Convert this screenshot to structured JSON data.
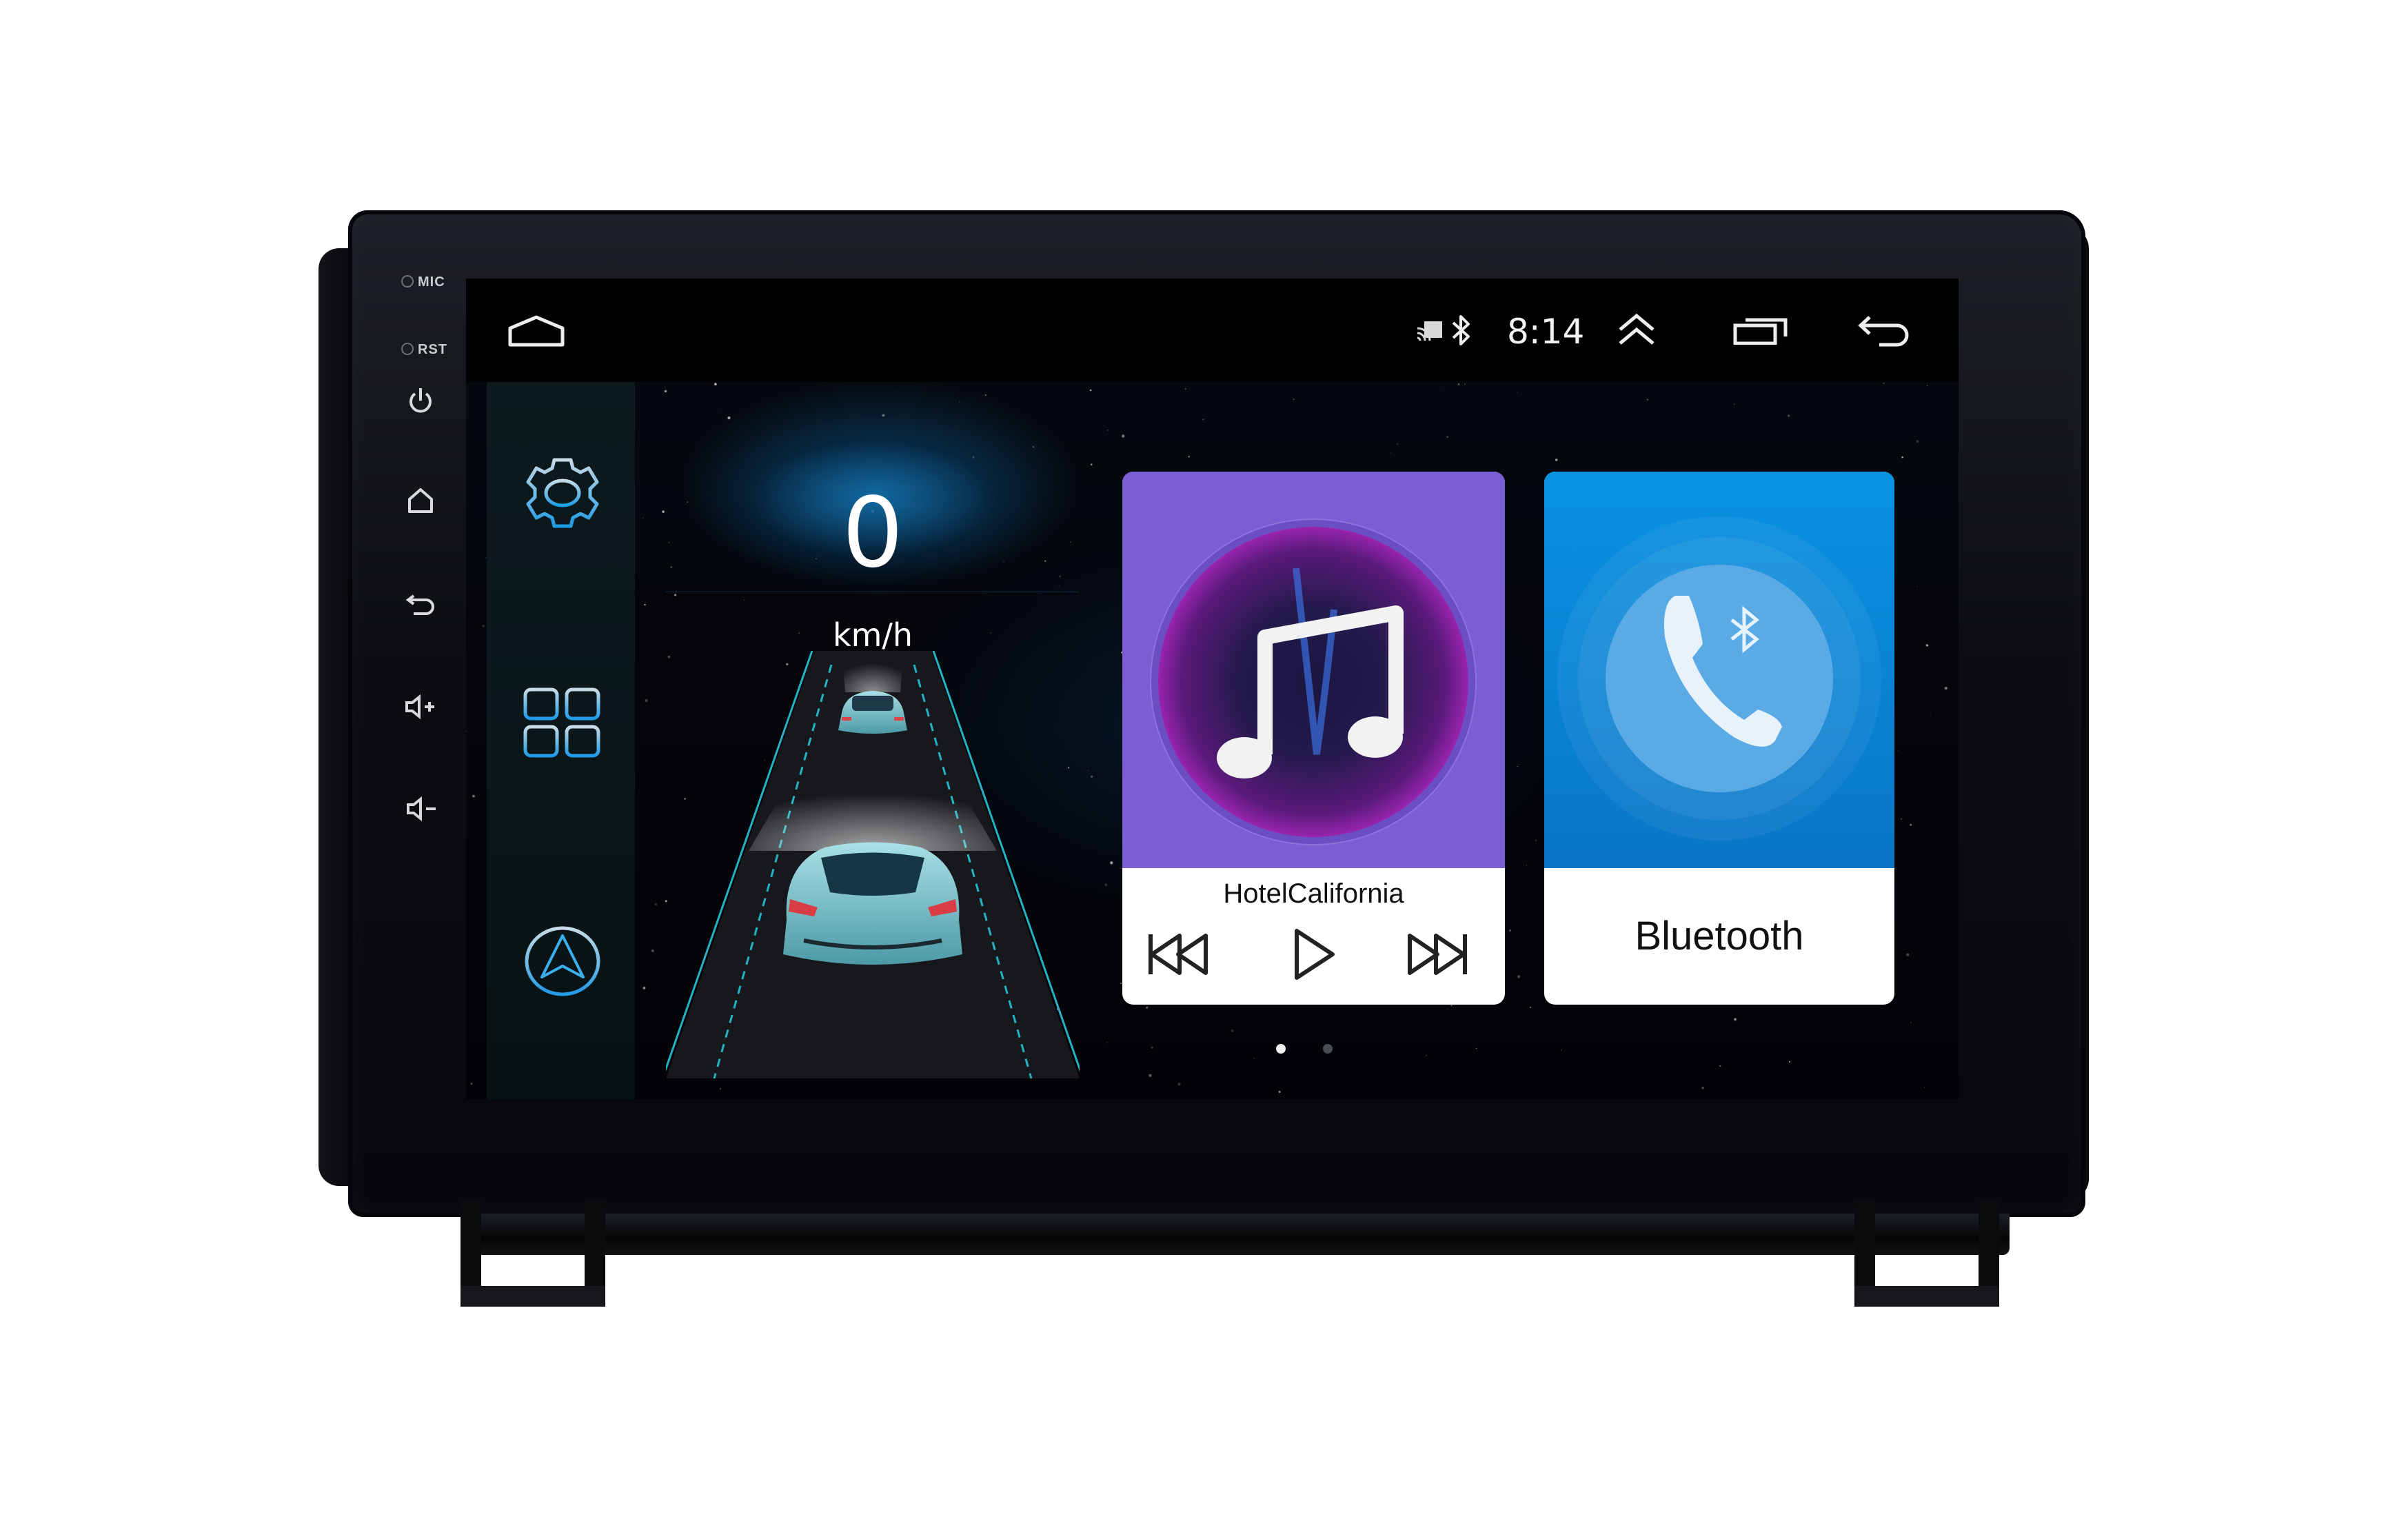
{
  "device": {
    "hardware_labels": {
      "mic": "MIC",
      "rst": "RST"
    },
    "hardware_buttons": [
      "power-icon",
      "home-icon",
      "back-icon",
      "volume-up-icon",
      "volume-down-icon"
    ]
  },
  "status_bar": {
    "home_icon": "home-icon",
    "cast_icon": "cast-icon",
    "bluetooth_icon": "bluetooth-icon",
    "time": "8:14",
    "expand_icon": "double-chevron-up-icon",
    "recents_icon": "recent-apps-icon",
    "back_icon": "back-icon"
  },
  "dock": {
    "items": [
      {
        "name": "settings",
        "icon": "gear-icon"
      },
      {
        "name": "apps",
        "icon": "app-grid-icon"
      },
      {
        "name": "navigation",
        "icon": "navigation-arrow-icon"
      }
    ]
  },
  "speedometer": {
    "value": "0",
    "unit": "km/h"
  },
  "music_widget": {
    "track_title": "HotelCalifornia",
    "controls": [
      "previous-track-icon",
      "play-icon",
      "next-track-icon"
    ],
    "accent_color": "#7a5fd3"
  },
  "bluetooth_widget": {
    "label": "Bluetooth",
    "accent_color": "#0a87d6"
  },
  "pagination": {
    "pages": 2,
    "current_page": 1
  },
  "colors": {
    "dock_icon_blue": "#2a9fe0",
    "screen_bg": "#000000",
    "card_text": "#111111"
  }
}
